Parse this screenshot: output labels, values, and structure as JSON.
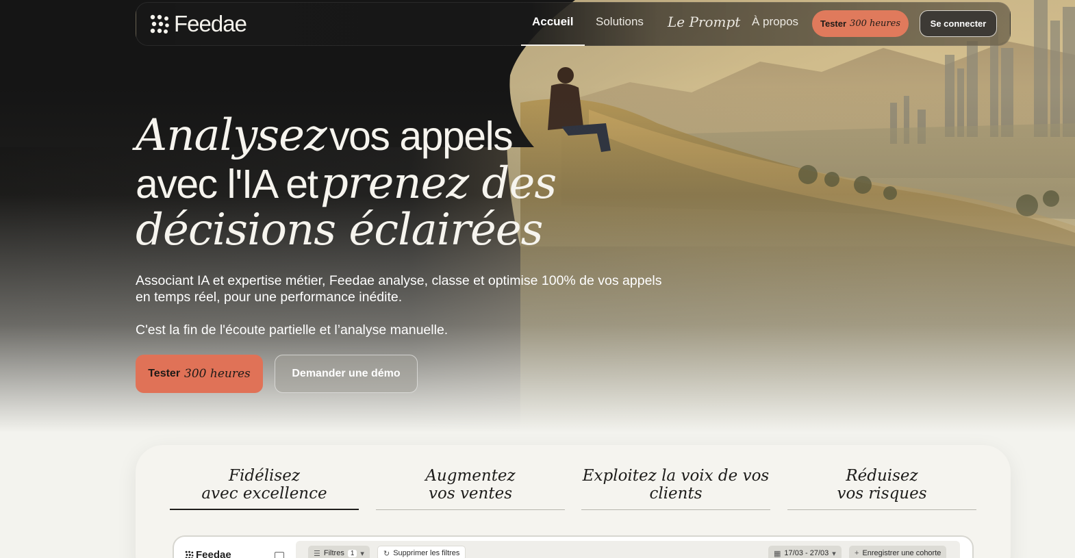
{
  "brand": {
    "name": "Feedae"
  },
  "nav": {
    "items": [
      {
        "label": "Accueil",
        "active": true
      },
      {
        "label": "Solutions"
      },
      {
        "label": "Le Prompt"
      },
      {
        "label": "À propos"
      }
    ],
    "try_button": {
      "label": "Tester",
      "label_italic": "300 heures"
    },
    "login_button": {
      "label": "Se connecter"
    }
  },
  "hero": {
    "headline": {
      "line1_italic": "Analysez",
      "line1_plain": "vos appels",
      "line2_plain": "avec l'IA et",
      "line2_italic": "prenez des",
      "line3_italic": "décisions éclairées"
    },
    "subtitle": "Associant IA et expertise métier, Feedae analyse, classe et optimise 100% de vos appels en temps réel, pour une performance inédite.",
    "subtitle2": "C'est la fin de l'écoute partielle et l’analyse manuelle.",
    "cta_primary": {
      "label": "Tester",
      "label_italic": "300 heures"
    },
    "cta_secondary": {
      "label": "Demander une démo"
    }
  },
  "features": {
    "tabs": [
      {
        "line1": "Fidélisez",
        "line2": "avec excellence",
        "active": true
      },
      {
        "line1": "Augmentez",
        "line2": "vos ventes"
      },
      {
        "line1": "Exploitez la voix de vos",
        "line2": "clients"
      },
      {
        "line1": "Réduisez",
        "line2": "vos risques"
      }
    ]
  },
  "app_preview": {
    "logo": "Feedae",
    "filters_label": "Filtres",
    "filters_count": "1",
    "clear_filters": "Supprimer les filtres",
    "date_range": "17/03 - 27/03",
    "save_cohort": "Enregistrer une cohorte"
  },
  "colors": {
    "accent": "#e07257",
    "dark": "#1a1a1a",
    "light_bg": "#f3f3ee"
  }
}
